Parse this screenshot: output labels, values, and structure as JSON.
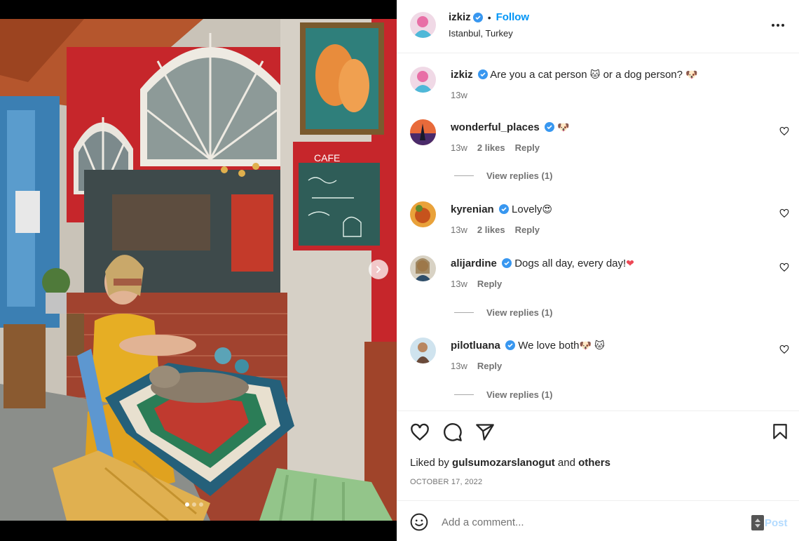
{
  "post": {
    "username": "izkiz",
    "separator": "•",
    "follow_label": "Follow",
    "location": "Istanbul, Turkey"
  },
  "comments": [
    {
      "username": "izkiz",
      "text": "Are you a cat person",
      "emoji1": "🐱",
      "text2": "or a dog person?",
      "emoji2": "🐶",
      "age": "13w"
    },
    {
      "username": "wonderful_places",
      "emoji": "🐶",
      "age": "13w",
      "likes": "2 likes",
      "reply": "Reply",
      "view_replies": "View replies (1)"
    },
    {
      "username": "kyrenian",
      "text": "Lovely",
      "emoji": "😍",
      "age": "13w",
      "likes": "2 likes",
      "reply": "Reply"
    },
    {
      "username": "alijardine",
      "text": "Dogs all day, every day!",
      "emoji": "❤",
      "age": "13w",
      "reply": "Reply",
      "view_replies": "View replies (1)"
    },
    {
      "username": "pilotluana",
      "text": "We love both",
      "emoji1": "🐶",
      "emoji2": "🐱",
      "age": "13w",
      "reply": "Reply",
      "view_replies": "View replies (1)"
    }
  ],
  "actions": {
    "liked_prefix": "Liked by",
    "liked_user": "gulsumozarslanogut",
    "liked_and": "and",
    "liked_others": "others",
    "date": "OCTOBER 17, 2022"
  },
  "add_comment": {
    "placeholder": "Add a comment...",
    "post_label": "Post"
  },
  "icons": {
    "verified": "verified-badge-icon",
    "more": "more-options-icon",
    "heart": "heart-icon",
    "comment": "comment-icon",
    "share": "share-icon",
    "save": "bookmark-icon",
    "emoji": "emoji-smile-icon",
    "next": "chevron-right-icon"
  },
  "colors": {
    "accent": "#0095f6",
    "verified": "#3897f0",
    "muted": "#737373",
    "like_red": "#ed4956"
  },
  "carousel": {
    "slides": 3,
    "active": 1
  }
}
